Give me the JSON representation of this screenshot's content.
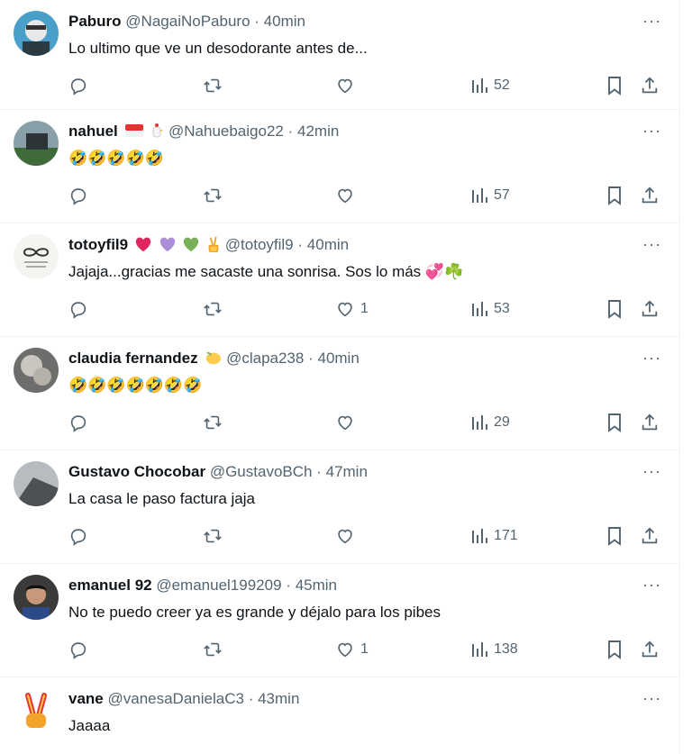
{
  "icons": {
    "reply": "reply-icon",
    "retweet": "retweet-icon",
    "like": "heart-icon",
    "views": "views-bar-chart-icon",
    "bookmark": "bookmark-icon",
    "share": "share-icon",
    "more": "more-options-icon"
  },
  "colors": {
    "secondary_text": "#536471",
    "divider": "#eff3f4"
  },
  "replies": [
    {
      "name": "Paburo",
      "handle": "@NagaiNoPaburo",
      "dot": "·",
      "time": "40min",
      "text": "Lo ultimo que ve un desodorante antes de...",
      "likes": "",
      "views": "52",
      "more": "···"
    },
    {
      "name": "nahuel",
      "handle": "@Nahuebaigo22",
      "dot": "·",
      "time": "42min",
      "text": "🤣🤣🤣🤣🤣",
      "likes": "",
      "views": "57",
      "more": "···"
    },
    {
      "name": "totoyfil9",
      "handle": "@totoyfil9",
      "dot": "·",
      "time": "40min",
      "text": "Jajaja...gracias me sacaste una sonrisa. Sos lo más 💞☘️",
      "likes": "1",
      "views": "53",
      "more": "···"
    },
    {
      "name": "claudia fernandez",
      "handle": "@clapa238",
      "dot": "·",
      "time": "40min",
      "text": "🤣🤣🤣🤣🤣🤣🤣",
      "likes": "",
      "views": "29",
      "more": "···"
    },
    {
      "name": "Gustavo Chocobar",
      "handle": "@GustavoBCh",
      "dot": "·",
      "time": "47min",
      "text": "La casa le paso factura jaja",
      "likes": "",
      "views": "171",
      "more": "···"
    },
    {
      "name": "emanuel 92",
      "handle": "@emanuel199209",
      "dot": "·",
      "time": "45min",
      "text": "No te puedo creer ya es grande y déjalo para los pibes",
      "likes": "1",
      "views": "138",
      "more": "···"
    },
    {
      "name": "vane",
      "handle": "@vanesaDanielaC3",
      "dot": "·",
      "time": "43min",
      "text": "Jaaaa",
      "likes": "",
      "views": "",
      "more": "···"
    }
  ]
}
